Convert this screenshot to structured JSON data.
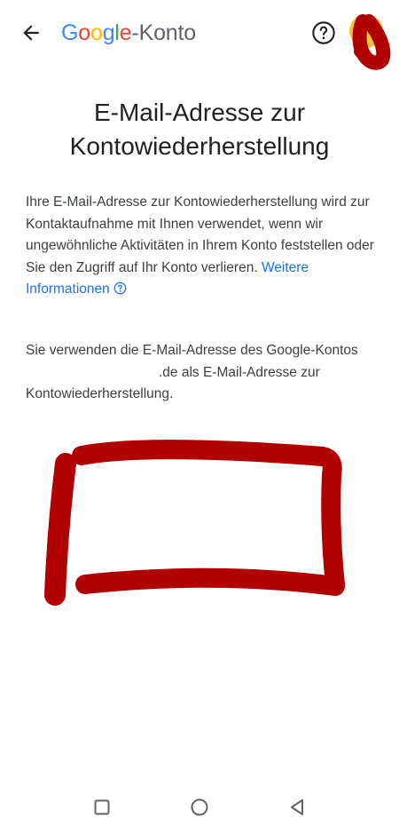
{
  "header": {
    "brand_g1": "G",
    "brand_g2": "o",
    "brand_g3": "o",
    "brand_g4": "g",
    "brand_g5": "l",
    "brand_g6": "e",
    "brand_dash": "-",
    "brand_konto": "Konto",
    "back_icon": "arrow-left-icon",
    "help_icon": "help-circle-icon"
  },
  "main": {
    "title": "E-Mail-Adresse zur Kontowiederherstellung",
    "description": "Ihre E-Mail-Adresse zur Kontowiederherstellung wird zur Kontaktaufnahme mit Ihnen verwendet, wenn wir ungewöhnliche Aktivitäten in Ihrem Konto feststellen oder Sie den Zugriff auf Ihr Konto verlieren.",
    "learn_more": "Weitere Informationen",
    "status_prefix": "Sie verwenden die E-Mail-Adresse des Google-Kontos",
    "status_domain": ".de als E-Mail-Adresse zur Kontowiederherstellung."
  },
  "colors": {
    "link": "#1a73e8",
    "scribble": "#b00000",
    "avatar": "#f4c430"
  },
  "navbar": {
    "recents_icon": "square-icon",
    "home_icon": "circle-icon",
    "back_icon": "triangle-back-icon"
  }
}
